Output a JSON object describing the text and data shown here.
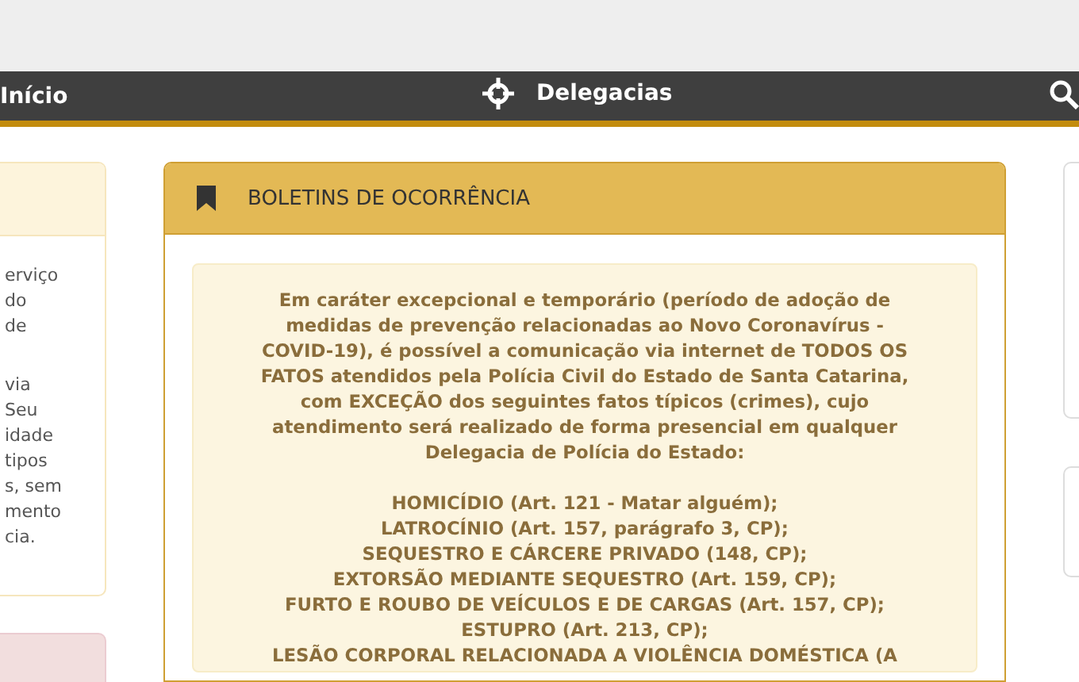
{
  "top_nav": {
    "home_link": "Início",
    "center_link": "Delegacias"
  },
  "left_card": {
    "paragraphs": [
      [
        "erviço",
        "do",
        "de"
      ],
      [
        "via",
        "Seu",
        "idade",
        "tipos",
        "s, sem",
        "mento",
        "cia."
      ]
    ]
  },
  "main_card": {
    "title": "BOLETINS DE OCORRÊNCIA",
    "notice": "Em caráter excepcional e temporário (período de adoção de medidas de prevenção relacionadas ao Novo Coronavírus - COVID-19), é possível a comunicação via internet de TODOS OS FATOS atendidos pela Polícia Civil do Estado de Santa Catarina, com EXCEÇÃO dos seguintes fatos típicos (crimes), cujo atendimento será realizado de forma presencial em qualquer Delegacia de Polícia do Estado:",
    "crimes": [
      "HOMICÍDIO (Art. 121 - Matar alguém);",
      "LATROCÍNIO (Art. 157, parágrafo 3, CP);",
      "SEQUESTRO E CÁRCERE PRIVADO (148, CP);",
      "EXTORSÃO MEDIANTE SEQUESTRO (Art. 159, CP);",
      "FURTO E ROUBO DE VEÍCULOS E DE CARGAS (Art. 157, CP);",
      "ESTUPRO (Art. 213, CP);",
      "LESÃO CORPORAL RELACIONADA A VIOLÊNCIA DOMÉSTICA (A"
    ]
  }
}
